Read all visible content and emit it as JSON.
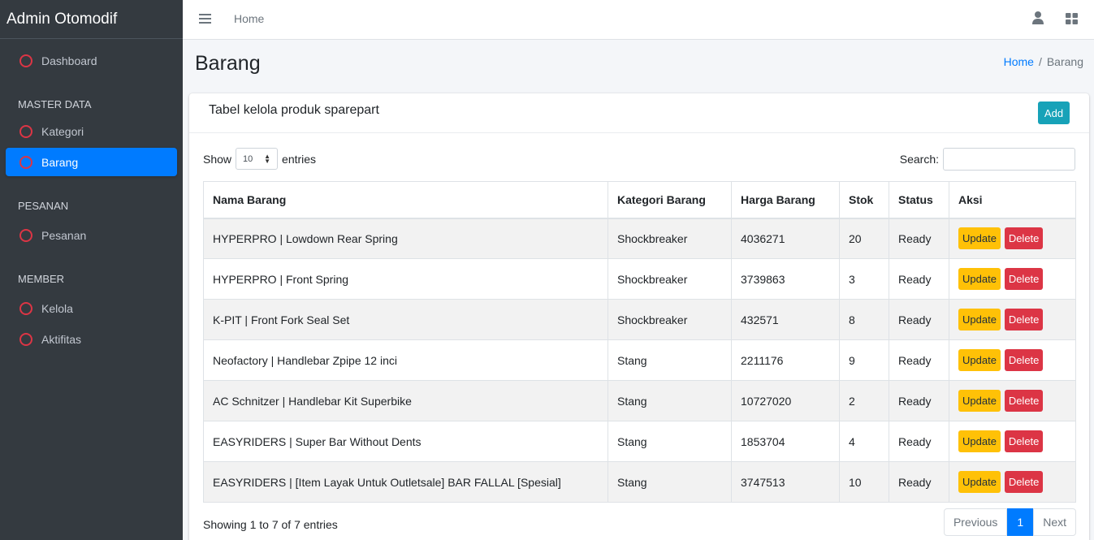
{
  "sidebar": {
    "brand": "Admin Otomodif",
    "dashboard": "Dashboard",
    "master_header": "MASTER DATA",
    "kategori": "Kategori",
    "barang": "Barang",
    "pesanan_header": "PESANAN",
    "pesanan": "Pesanan",
    "member_header": "MEMBER",
    "kelola": "Kelola",
    "aktifitas": "Aktifitas"
  },
  "topbar": {
    "home": "Home"
  },
  "page": {
    "title": "Barang",
    "breadcrumb_home": "Home",
    "breadcrumb_sep": "/",
    "breadcrumb_current": "Barang"
  },
  "card": {
    "title": "Tabel kelola produk sparepart",
    "add_label": "Add"
  },
  "table_controls": {
    "show_label": "Show",
    "entries_value": "10",
    "entries_label": "entries",
    "search_label": "Search:"
  },
  "table": {
    "headers": [
      "Nama Barang",
      "Kategori Barang",
      "Harga Barang",
      "Stok",
      "Status",
      "Aksi"
    ],
    "update_label": "Update",
    "delete_label": "Delete",
    "rows": [
      {
        "nama": "HYPERPRO | Lowdown Rear Spring",
        "kategori": "Shockbreaker",
        "harga": "4036271",
        "stok": "20",
        "status": "Ready"
      },
      {
        "nama": "HYPERPRO | Front Spring",
        "kategori": "Shockbreaker",
        "harga": "3739863",
        "stok": "3",
        "status": "Ready"
      },
      {
        "nama": "K-PIT | Front Fork Seal Set",
        "kategori": "Shockbreaker",
        "harga": "432571",
        "stok": "8",
        "status": "Ready"
      },
      {
        "nama": "Neofactory | Handlebar Zpipe 12 inci",
        "kategori": "Stang",
        "harga": "2211176",
        "stok": "9",
        "status": "Ready"
      },
      {
        "nama": "AC Schnitzer | Handlebar Kit Superbike",
        "kategori": "Stang",
        "harga": "10727020",
        "stok": "2",
        "status": "Ready"
      },
      {
        "nama": "EASYRIDERS | Super Bar Without Dents",
        "kategori": "Stang",
        "harga": "1853704",
        "stok": "4",
        "status": "Ready"
      },
      {
        "nama": "EASYRIDERS | [Item Layak Untuk Outletsale] BAR FALLAL [Spesial]",
        "kategori": "Stang",
        "harga": "3747513",
        "stok": "10",
        "status": "Ready"
      }
    ]
  },
  "footer": {
    "info": "Showing 1 to 7 of 7 entries",
    "previous": "Previous",
    "current_page": "1",
    "next": "Next"
  }
}
